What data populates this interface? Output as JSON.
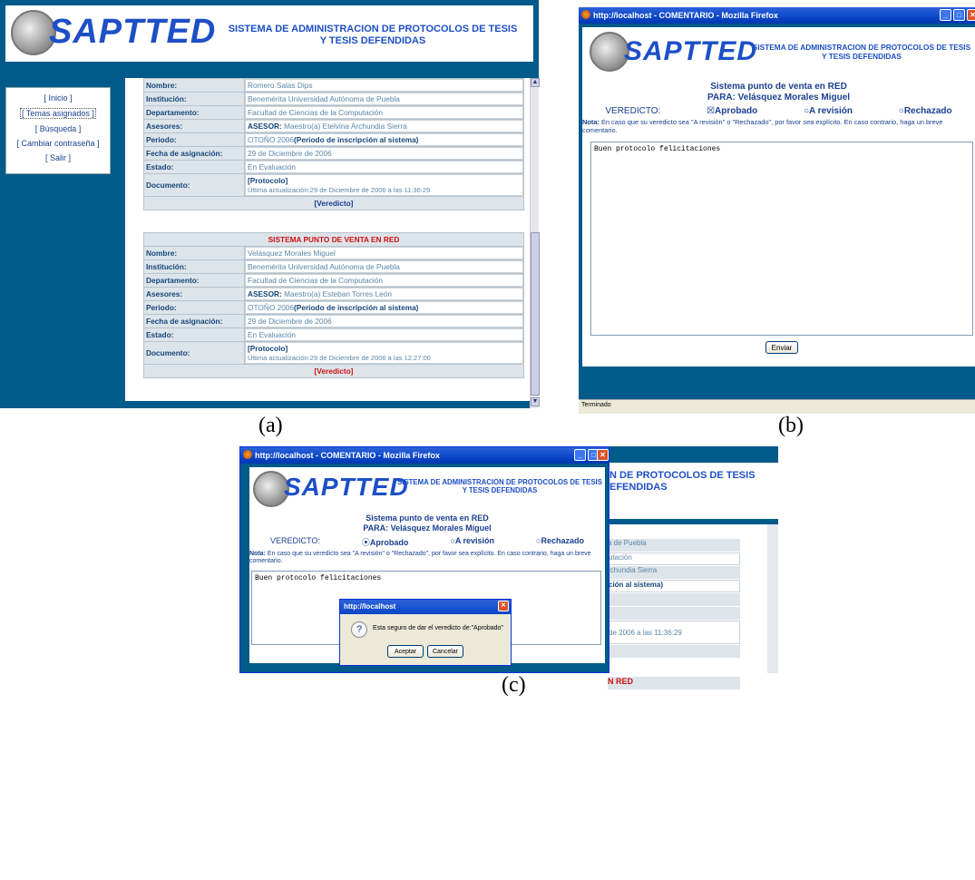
{
  "banner": {
    "title": "SAPTTED",
    "subtitle_line1": "SISTEMA DE ADMINISTRACION DE PROTOCOLOS DE TESIS",
    "subtitle_line2": "Y TESIS DEFENDIDAS"
  },
  "menu": {
    "items": [
      "[ Inicio ]",
      "[ Temas asignados ]",
      "[ Búsqueda ]",
      "[ Cambiar contraseña ]",
      "[ Salir ]"
    ]
  },
  "record1": {
    "nombre_label": "Nombre:",
    "nombre": "Romero Salas Dips",
    "institucion_label": "Institución:",
    "institucion": "Benemérita Universidad Autónoma de Puebla",
    "departamento_label": "Departamento:",
    "departamento": "Facultad de Ciencias de la Computación",
    "asesores_label": "Asesores:",
    "asesor_prefix": "ASESOR:",
    "asesor": " Maestro(a) Etelvina Archundia Sierra",
    "periodo_label": "Periodo:",
    "periodo": "OTOÑO 2006",
    "periodo_note": "(Periodo de inscripción al sistema)",
    "fecha_label": "Fecha de asignación:",
    "fecha": "29 de Diciembre de 2006",
    "estado_label": "Estado:",
    "estado": "En Evaluación",
    "documento_label": "Documento:",
    "doc_link": "[Protocolo]",
    "doc_update": "Última actualización:29 de Diciembre de 2006 a las 11:36:29",
    "veredicto": "[Veredicto]"
  },
  "record2": {
    "title": "SISTEMA PUNTO DE VENTA EN RED",
    "nombre_label": "Nombre:",
    "nombre": "Velásquez Morales Miguel",
    "institucion_label": "Institución:",
    "institucion": "Benemérita Universidad Autónoma de Puebla",
    "departamento_label": "Departamento:",
    "departamento": "Facultad de Ciencias de la Computación",
    "asesores_label": "Asesores:",
    "asesor_prefix": "ASESOR:",
    "asesor": " Maestro(a) Esteban Torres León",
    "periodo_label": "Periodo:",
    "periodo": "OTOÑO 2006",
    "periodo_note": "(Periodo de inscripción al sistema)",
    "fecha_label": "Fecha de asignación:",
    "fecha": "29 de Diciembre de 2006",
    "estado_label": "Estado:",
    "estado": "En Evaluación",
    "documento_label": "Documento:",
    "doc_link": "[Protocolo]",
    "doc_update": "Última actualización:29 de Diciembre de 2006 a las 12:27:00",
    "veredicto": "[Veredicto]"
  },
  "window": {
    "title": "http://localhost - COMENTARIO - Mozilla Firefox",
    "status": "Terminado"
  },
  "comment": {
    "line1": "Sistema punto de venta en RED",
    "line2": "PARA: Velásquez Morales Miguel",
    "veredicto_label": "VEREDICTO:",
    "opt_aprobado": "Aprobado",
    "opt_revision": "A revisión",
    "opt_rechazado": "Rechazado",
    "note_prefix": "Nota:",
    "note": " En caso que su veredicto sea \"A revisión\" o \"Rechazado\", por favor sea explícito. En caso contrario, haga un breve comentario.",
    "text": "Buen protocolo felicitaciones",
    "send": "Enviar"
  },
  "dialog": {
    "title": "http://localhost",
    "message": "Esta seguro de dar el veredicto de:\"Aprobado\"",
    "ok": "Aceptar",
    "cancel": "Cancelar"
  },
  "background_fragments": {
    "banner_frag1": "N DE PROTOCOLOS DE TESIS",
    "banner_frag2": "EFENDIDAS",
    "rows1": [
      "a de Puebla",
      "utación",
      "rchundia Sierra",
      "ción al sistema)",
      "",
      "",
      "de 2006 a las 11:36:29",
      ""
    ],
    "red_frag": "N RED",
    "rows2": [
      "",
      "a de Puebla",
      "utación",
      "rres León",
      "ción al sistema)",
      "",
      "",
      "de 2006 a las 12:27:00"
    ],
    "veredicto_frag": "[Veredicto]"
  },
  "captions": {
    "a": "(a)",
    "b": "(b)",
    "c": "(c)"
  },
  "colors": {
    "app_bg": "#005a8a",
    "brand": "#1d4fc7",
    "red": "#d21010"
  }
}
